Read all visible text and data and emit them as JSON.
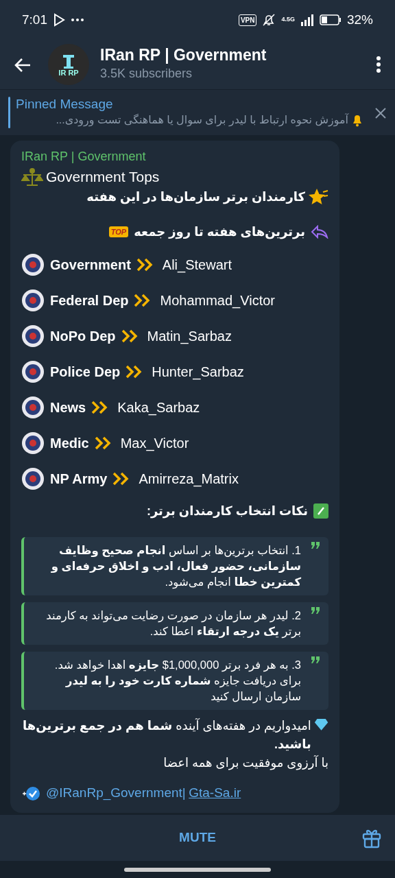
{
  "status_bar": {
    "time": "7:01",
    "vpn": "VPN",
    "network": "4.5G",
    "battery": "32%"
  },
  "header": {
    "title": "IRan RP | Government",
    "subtitle": "3.5K subscribers",
    "avatar_text": "IR RP"
  },
  "pinned": {
    "label": "Pinned Message",
    "text": "آموزش نحوه ارتباط با لیدر برای سوال یا هماهنگی تست ورودی..."
  },
  "message": {
    "author": "IRan RP | Government",
    "title": "Government Tops",
    "headline": "کارمندان برتر سازمان‌ها در این هفته",
    "subheadline": "برترین‌های هفته تا روز جمعه",
    "top_badge": "TOP",
    "rows": [
      {
        "org": "Government",
        "person": "Ali_Stewart"
      },
      {
        "org": "Federal Dep",
        "person": "Mohammad_Victor"
      },
      {
        "org": "NoPo Dep",
        "person": "Matin_Sarbaz"
      },
      {
        "org": "Police Dep",
        "person": "Hunter_Sarbaz"
      },
      {
        "org": "News",
        "person": "Kaka_Sarbaz"
      },
      {
        "org": "Medic",
        "person": "Max_Victor"
      },
      {
        "org": "NP Army",
        "person": "Amirreza_Matrix"
      }
    ],
    "tips_title": "نکات انتخاب کارمندان برتر:",
    "quotes": [
      "1. انتخاب برترین‌ها بر اساس **انجام صحیح وظایف سازمانی، حضور فعال، ادب و اخلاق حرفه‌ای و کمترین خطا** انجام می‌شود.",
      "2. لیدر هر سازمان در صورت رضایت می‌تواند به کارمند برتر **یک درجه ارتقاء** اعطا کند.",
      "3. به هر فرد برتر 1,000,000$ **جایزه** اهدا خواهد شد. برای دریافت جایزه **شماره کارت خود را به لیدر** سازمان ارسال کنید"
    ],
    "closing": "امیدواریم در هفته‌های آینده **شما هم در جمع برترین‌ها باشید.**",
    "wish": "با آرزوی موفقیت برای همه اعضا",
    "handle": "@IRanRp_Government|",
    "site": "Gta-Sa.ir"
  },
  "bottom_bar": {
    "button": "MUTE"
  }
}
